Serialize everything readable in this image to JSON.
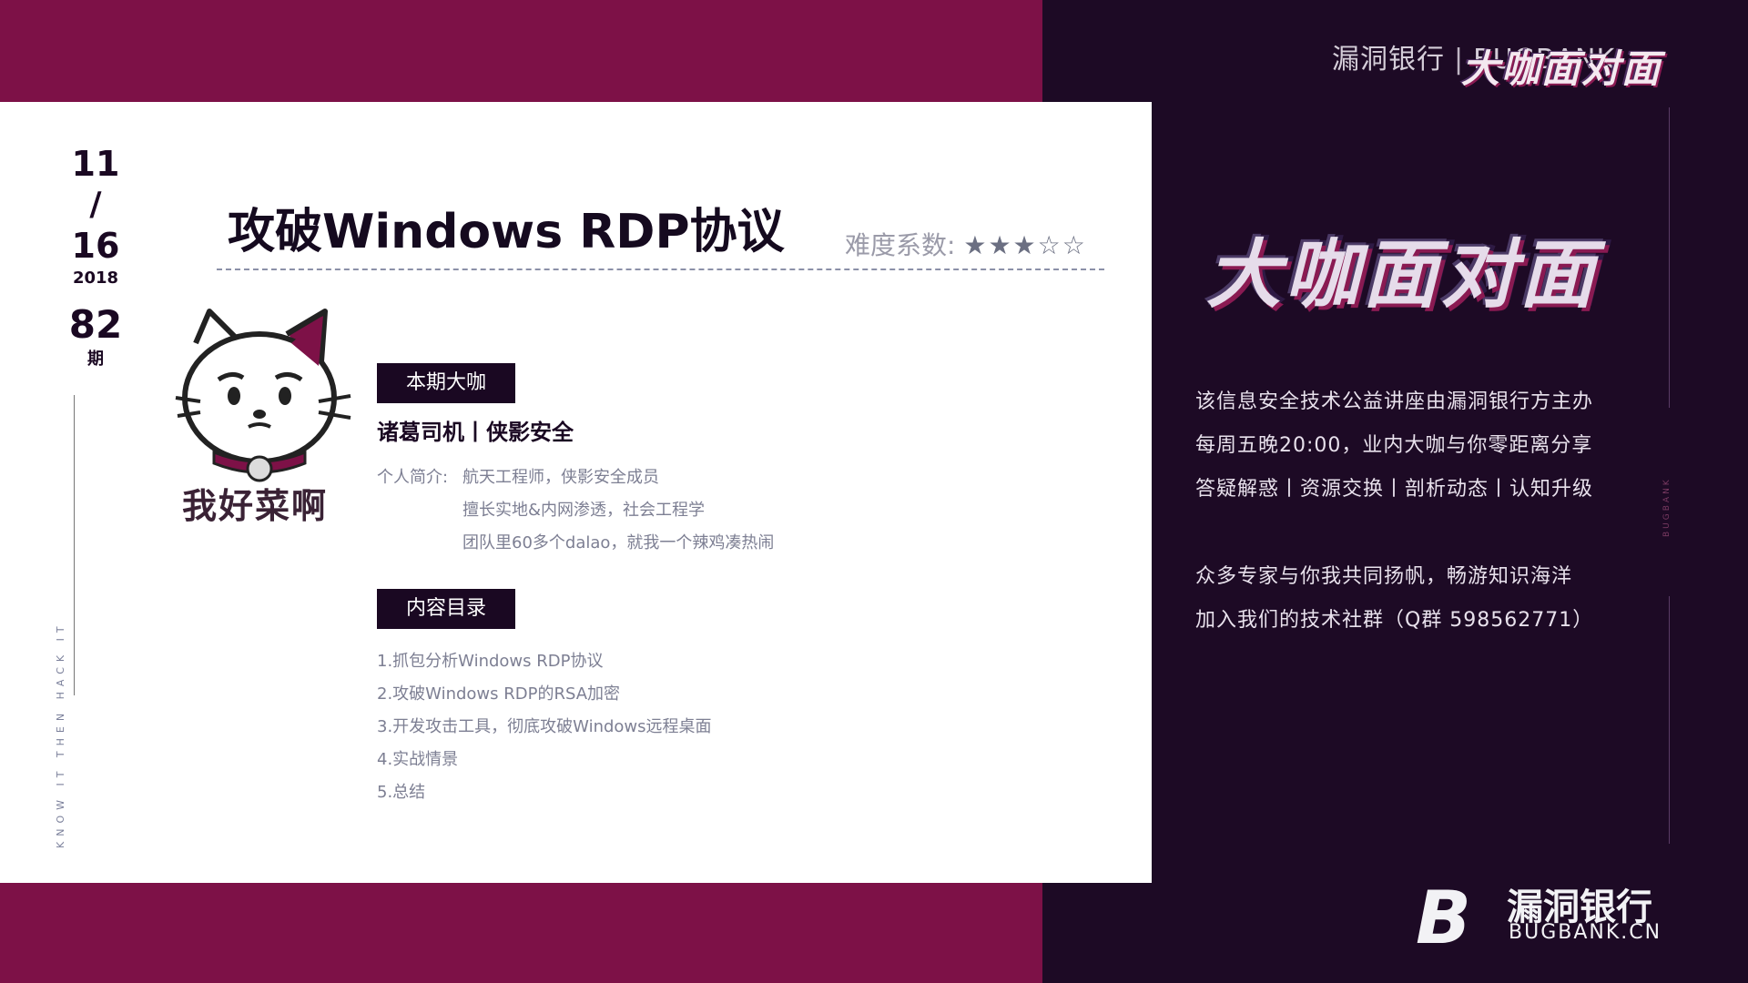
{
  "header": {
    "brand": "漏洞银行",
    "separator": "|",
    "brand_en": "BUGBANK",
    "logo_small": "大咖面对面"
  },
  "slide": {
    "date": {
      "month": "11",
      "slash": "/",
      "day": "16",
      "year": "2018"
    },
    "issue": {
      "number": "82",
      "label": "期"
    },
    "vertical_text": "KNOW IT THEN HACK IT",
    "title": "攻破Windows RDP协议",
    "difficulty": {
      "label": "难度系数:",
      "stars": "★★★☆☆",
      "rating": 3,
      "max": 5
    },
    "avatar_caption": "我好菜啊",
    "guest": {
      "tag": "本期大咖",
      "name": "诸葛司机丨侠影安全",
      "bio_label": "个人简介:",
      "bio": [
        "航天工程师，侠影安全成员",
        "擅长实地&内网渗透，社会工程学",
        "团队里60多个dalao，就我一个辣鸡凑热闹"
      ]
    },
    "toc": {
      "tag": "内容目录",
      "items": [
        "1.抓包分析Windows RDP协议",
        "2.攻破Windows RDP的RSA加密",
        "3.开发攻击工具，彻底攻破Windows远程桌面",
        "4.实战情景",
        "5.总结"
      ]
    }
  },
  "side": {
    "logo": "大咖面对面",
    "vertical_text": "BUGBANK",
    "info": [
      "该信息安全技术公益讲座由漏洞银行方主办",
      "每周五晚20:00，业内大咖与你零距离分享",
      "答疑解惑丨资源交换丨剖析动态丨认知升级",
      "众多专家与你我共同扬帆，畅游知识海洋",
      "加入我们的技术社群（Q群 598562771）"
    ]
  },
  "footer_logo": {
    "mark": "B",
    "cn": "漏洞银行",
    "en": "BUGBANK.CN"
  },
  "colors": {
    "magenta": "#7d1147",
    "dark": "#1d0a25",
    "white": "#ffffff"
  }
}
